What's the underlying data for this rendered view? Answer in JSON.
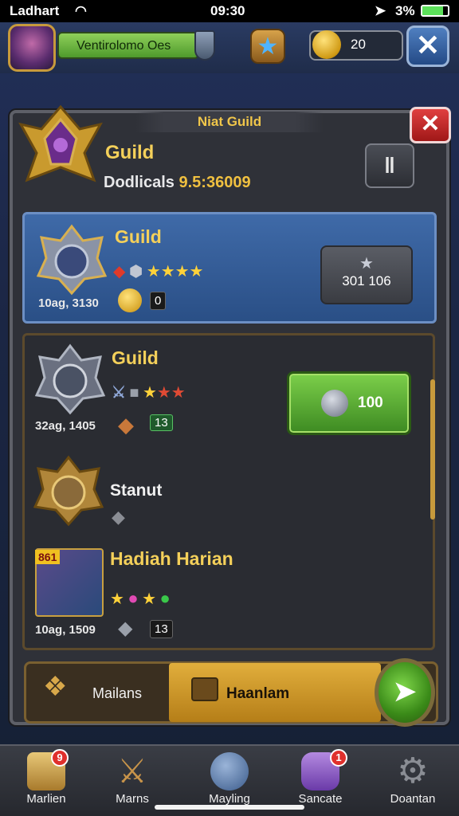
{
  "status_bar": {
    "carrier": "Ladhart",
    "time": "09:30",
    "battery": "3%"
  },
  "hud": {
    "player_name": "Ventirolomo Oes",
    "gold": "20"
  },
  "panel": {
    "title": "Niat  Guild",
    "guild_name": "Guild",
    "stats_label": "Dodlicals",
    "stats_value": "9.5:36009"
  },
  "rows": [
    {
      "title": "Guild",
      "sub": "10ag, 3130",
      "chip": "0",
      "button": "301 106"
    },
    {
      "title": "Guild",
      "sub": "32ag, 1405",
      "chip": "13",
      "button": "100"
    },
    {
      "title": "Stanut"
    },
    {
      "title": "Hadiah Harian",
      "sub": "10ag, 1509",
      "chip": "13",
      "tag": "861"
    }
  ],
  "tabs": [
    {
      "label": "Mailans"
    },
    {
      "label": "Haanlam"
    }
  ],
  "nav": [
    {
      "label": "Marlien",
      "badge": "9"
    },
    {
      "label": "Marns"
    },
    {
      "label": "Mayling"
    },
    {
      "label": "Sancate",
      "badge": "1"
    },
    {
      "label": "Doantan"
    }
  ],
  "colors": {
    "accent_gold": "#f4d05a",
    "selected_row": "#3f6aa8",
    "action_green": "#5cb132",
    "close_red": "#d02a2a"
  }
}
